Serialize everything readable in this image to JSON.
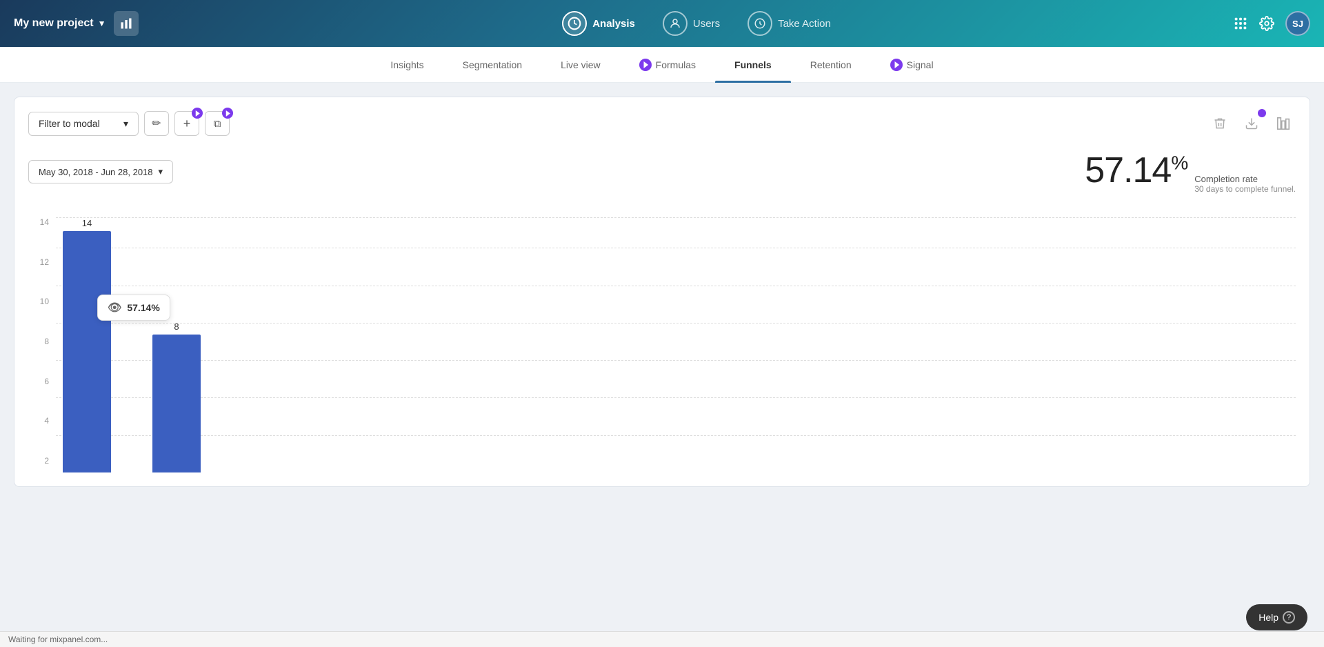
{
  "header": {
    "project_name": "My new project",
    "nav_items": [
      {
        "id": "analysis",
        "label": "Analysis",
        "icon": "analysis-icon",
        "active": true
      },
      {
        "id": "users",
        "label": "Users",
        "icon": "users-icon",
        "active": false
      },
      {
        "id": "take-action",
        "label": "Take Action",
        "icon": "take-action-icon",
        "active": false
      }
    ],
    "avatar": "SJ"
  },
  "subnav": {
    "items": [
      {
        "id": "insights",
        "label": "Insights",
        "active": false,
        "badge": false
      },
      {
        "id": "segmentation",
        "label": "Segmentation",
        "active": false,
        "badge": false
      },
      {
        "id": "live-view",
        "label": "Live view",
        "active": false,
        "badge": false
      },
      {
        "id": "formulas",
        "label": "Formulas",
        "active": false,
        "badge": true
      },
      {
        "id": "funnels",
        "label": "Funnels",
        "active": true,
        "badge": false
      },
      {
        "id": "retention",
        "label": "Retention",
        "active": false,
        "badge": false
      },
      {
        "id": "signal",
        "label": "Signal",
        "active": false,
        "badge": true
      }
    ]
  },
  "toolbar": {
    "filter_label": "Filter to modal",
    "edit_label": "✏",
    "add_label": "+",
    "copy_label": "⧉"
  },
  "chart": {
    "date_range": "May 30, 2018 - Jun 28, 2018",
    "completion_rate": "57.14",
    "completion_rate_label": "Completion rate",
    "completion_days": "30 days to complete funnel.",
    "y_labels": [
      "2",
      "4",
      "6",
      "8",
      "10",
      "12",
      "14"
    ],
    "bars": [
      {
        "value": 14,
        "height_pct": 100
      },
      {
        "value": 8,
        "height_pct": 57.14
      }
    ],
    "tooltip_value": "57.14%"
  },
  "help": {
    "label": "Help"
  },
  "status_bar": {
    "text": "Waiting for mixpanel.com..."
  }
}
